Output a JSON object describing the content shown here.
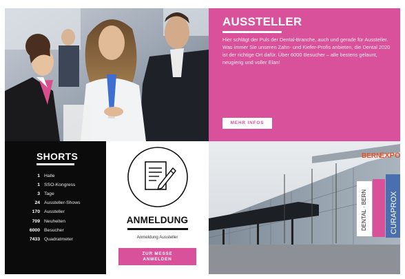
{
  "aussteller": {
    "title": "AUSSTELLER",
    "text": "Hier schlägt der Puls der Dental-Branche, auch und gerade für Aussteller. Was immer Sie unseren Zahn- und Kiefer-Profis anbieten, die Dental 2020 ist der richtige Ort dafür. Über 6000 Besucher – alle bestens gelaunt, neugierig und voller Elan!",
    "button_label": "MEHR INFOS"
  },
  "shorts": {
    "title": "SHORTS",
    "items": [
      {
        "num": "1",
        "label": "Halle"
      },
      {
        "num": "1",
        "label": "SSO-Kongress"
      },
      {
        "num": "3",
        "label": "Tage"
      },
      {
        "num": "24",
        "label": "Aussteller-Shows"
      },
      {
        "num": "170",
        "label": "Aussteller"
      },
      {
        "num": "709",
        "label": "Neuheiten"
      },
      {
        "num": "6000",
        "label": "Besucher"
      },
      {
        "num": "7433",
        "label": "Quadratmeter"
      }
    ]
  },
  "anmeldung": {
    "title": "ANMELDUNG",
    "subtitle": "Anmeldung Aussteller",
    "button_line1": "ZUR MESSE",
    "button_line2": "ANMELDEN",
    "icon": "document-pen-icon"
  },
  "building": {
    "sign_bern": "BERN",
    "sign_expo": "EXPO",
    "banner_dental": "DENTAL · BERN",
    "banner_curaprox": "CURAPROX"
  },
  "colors": {
    "accent": "#d9519b",
    "dark": "#0b0b0b",
    "sign_orange": "#e4552a",
    "banner_blue": "#4a6fb0"
  }
}
